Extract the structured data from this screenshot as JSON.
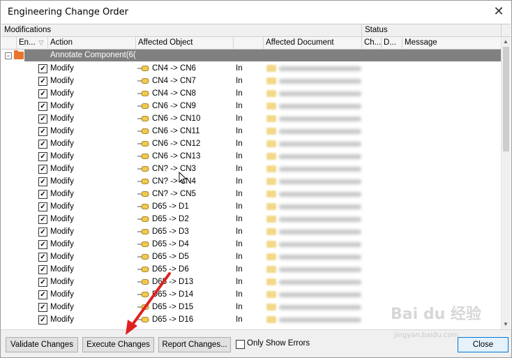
{
  "window": {
    "title": "Engineering Change Order",
    "close_glyph": "✕"
  },
  "groups": {
    "modifications": "Modifications",
    "status": "Status"
  },
  "columns": {
    "enable": "En...",
    "action": "Action",
    "affected_object": "Affected Object",
    "affected_document": "Affected Document",
    "check": "Ch...",
    "done": "D...",
    "message": "Message"
  },
  "group_header": {
    "label": "Annotate Component(6(",
    "expander": "−"
  },
  "rows": [
    {
      "checked": true,
      "action": "Modify",
      "object": "CN4 -> CN6",
      "in": "In"
    },
    {
      "checked": true,
      "action": "Modify",
      "object": "CN4 -> CN7",
      "in": "In"
    },
    {
      "checked": true,
      "action": "Modify",
      "object": "CN4 -> CN8",
      "in": "In"
    },
    {
      "checked": true,
      "action": "Modify",
      "object": "CN6 -> CN9",
      "in": "In"
    },
    {
      "checked": true,
      "action": "Modify",
      "object": "CN6 -> CN10",
      "in": "In"
    },
    {
      "checked": true,
      "action": "Modify",
      "object": "CN6 -> CN11",
      "in": "In"
    },
    {
      "checked": true,
      "action": "Modify",
      "object": "CN6 -> CN12",
      "in": "In"
    },
    {
      "checked": true,
      "action": "Modify",
      "object": "CN6 -> CN13",
      "in": "In"
    },
    {
      "checked": true,
      "action": "Modify",
      "object": "CN? -> CN3",
      "in": "In"
    },
    {
      "checked": true,
      "action": "Modify",
      "object": "CN? -> CN4",
      "in": "In"
    },
    {
      "checked": true,
      "action": "Modify",
      "object": "CN? -> CN5",
      "in": "In"
    },
    {
      "checked": true,
      "action": "Modify",
      "object": "D65 -> D1",
      "in": "In"
    },
    {
      "checked": true,
      "action": "Modify",
      "object": "D65 -> D2",
      "in": "In"
    },
    {
      "checked": true,
      "action": "Modify",
      "object": "D65 -> D3",
      "in": "In"
    },
    {
      "checked": true,
      "action": "Modify",
      "object": "D65 -> D4",
      "in": "In"
    },
    {
      "checked": true,
      "action": "Modify",
      "object": "D65 -> D5",
      "in": "In"
    },
    {
      "checked": true,
      "action": "Modify",
      "object": "D65 -> D6",
      "in": "In"
    },
    {
      "checked": true,
      "action": "Modify",
      "object": "D65 -> D13",
      "in": "In"
    },
    {
      "checked": true,
      "action": "Modify",
      "object": "D65 -> D14",
      "in": "In"
    },
    {
      "checked": true,
      "action": "Modify",
      "object": "D65 -> D15",
      "in": "In"
    },
    {
      "checked": true,
      "action": "Modify",
      "object": "D65 -> D16",
      "in": "In"
    }
  ],
  "buttons": {
    "validate": "Validate Changes",
    "execute": "Execute Changes",
    "report": "Report Changes...",
    "only_errors": "Only Show Errors",
    "close": "Close"
  },
  "only_show_errors_checked": false,
  "watermark": {
    "main": "Bai du 经验",
    "sub": "jingyan.baidu.com"
  },
  "colors": {
    "group_bar": "#808080",
    "arrow": "#e02020",
    "folder": "#e8742e",
    "close_border": "#0078d7"
  },
  "icons": {
    "close": "close-icon",
    "folder": "folder-icon",
    "component": "component-icon",
    "document": "document-icon",
    "cursor": "mouse-cursor-icon"
  }
}
